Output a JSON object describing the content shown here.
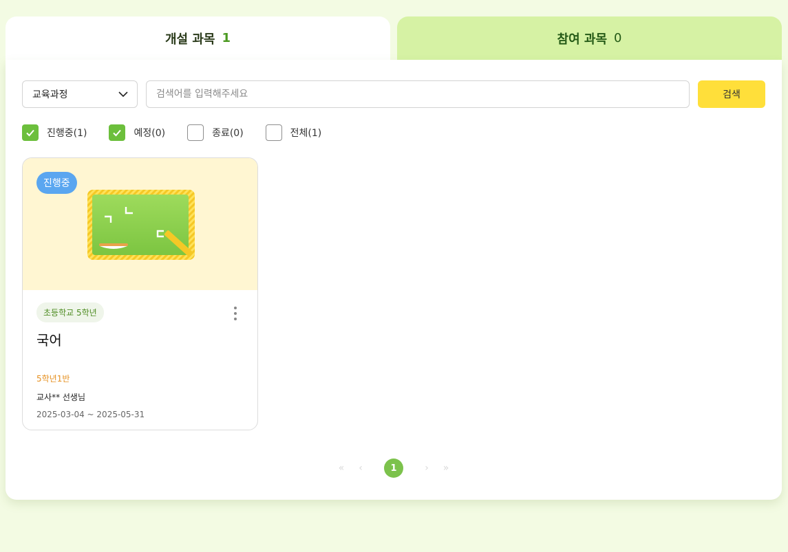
{
  "tabs": [
    {
      "label": "개설 과목",
      "count": "1",
      "active": true
    },
    {
      "label": "참여 과목",
      "count": "0",
      "active": false
    }
  ],
  "search": {
    "select_value": "교육과정",
    "placeholder": "검색어를 입력해주세요",
    "button_label": "검색"
  },
  "filters": [
    {
      "label": "진행중(1)",
      "checked": true
    },
    {
      "label": "예정(0)",
      "checked": true
    },
    {
      "label": "종료(0)",
      "checked": false
    },
    {
      "label": "전체(1)",
      "checked": false
    }
  ],
  "card": {
    "status": "진행중",
    "grade": "초등학교 5학년",
    "title": "국어",
    "class_name": "5학년1반",
    "teacher": "교사** 선생님",
    "period": "2025-03-04 ~ 2025-05-31",
    "icon": "chalkboard-icon"
  },
  "pagination": {
    "current": "1",
    "first": "«",
    "prev": "‹",
    "next": "›",
    "last": "»"
  },
  "colors": {
    "accent_green": "#6cbf3c",
    "search_button": "#ffdf3a",
    "status_badge": "#5aa6f0",
    "class_name": "#e69020",
    "inactive_tab": "#d6f2a4",
    "page_bg": "#f3fbe3"
  }
}
